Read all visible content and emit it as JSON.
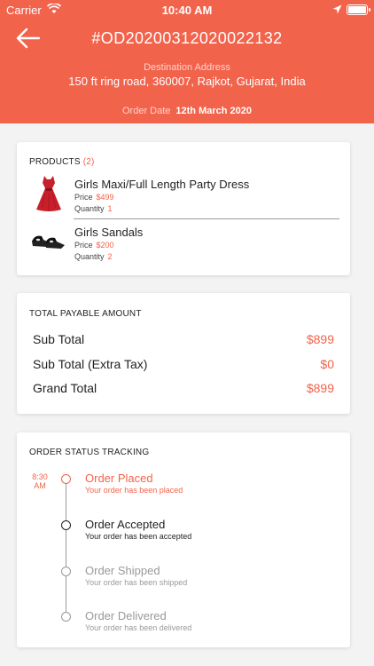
{
  "status_bar": {
    "carrier": "Carrier",
    "time": "10:40 AM"
  },
  "header": {
    "order_id": "#OD20200312020022132",
    "destination_label": "Destination Address",
    "destination_address": "150 ft ring road, 360007, Rajkot, Gujarat, India",
    "order_date_label": "Order Date",
    "order_date": "12th March 2020"
  },
  "products": {
    "title": "PRODUCTS",
    "count": "(2)",
    "items": [
      {
        "name": "Girls Maxi/Full Length Party Dress",
        "price_label": "Price",
        "price": "$499",
        "qty_label": "Quantity",
        "qty": "1",
        "icon": "dress-icon"
      },
      {
        "name": "Girls Sandals",
        "price_label": "Price",
        "price": "$200",
        "qty_label": "Quantity",
        "qty": "2",
        "icon": "sandals-icon"
      }
    ]
  },
  "totals": {
    "title": "TOTAL PAYABLE AMOUNT",
    "rows": [
      {
        "label": "Sub Total",
        "value": "$899"
      },
      {
        "label": "Sub Total (Extra Tax)",
        "value": "$0"
      },
      {
        "label": "Grand Total",
        "value": "$899"
      }
    ]
  },
  "tracking": {
    "title": "ORDER STATUS TRACKING",
    "time_line1": "8:30",
    "time_line2": "AM",
    "steps": [
      {
        "title": "Order Placed",
        "desc": "Your order has been placed"
      },
      {
        "title": "Order Accepted",
        "desc": "Your order has been accepted"
      },
      {
        "title": "Order Shipped",
        "desc": "Your order has been shipped"
      },
      {
        "title": "Order Delivered",
        "desc": "Your order has been delivered"
      }
    ]
  },
  "colors": {
    "accent": "#f2634c",
    "background": "#f3f3f3"
  }
}
